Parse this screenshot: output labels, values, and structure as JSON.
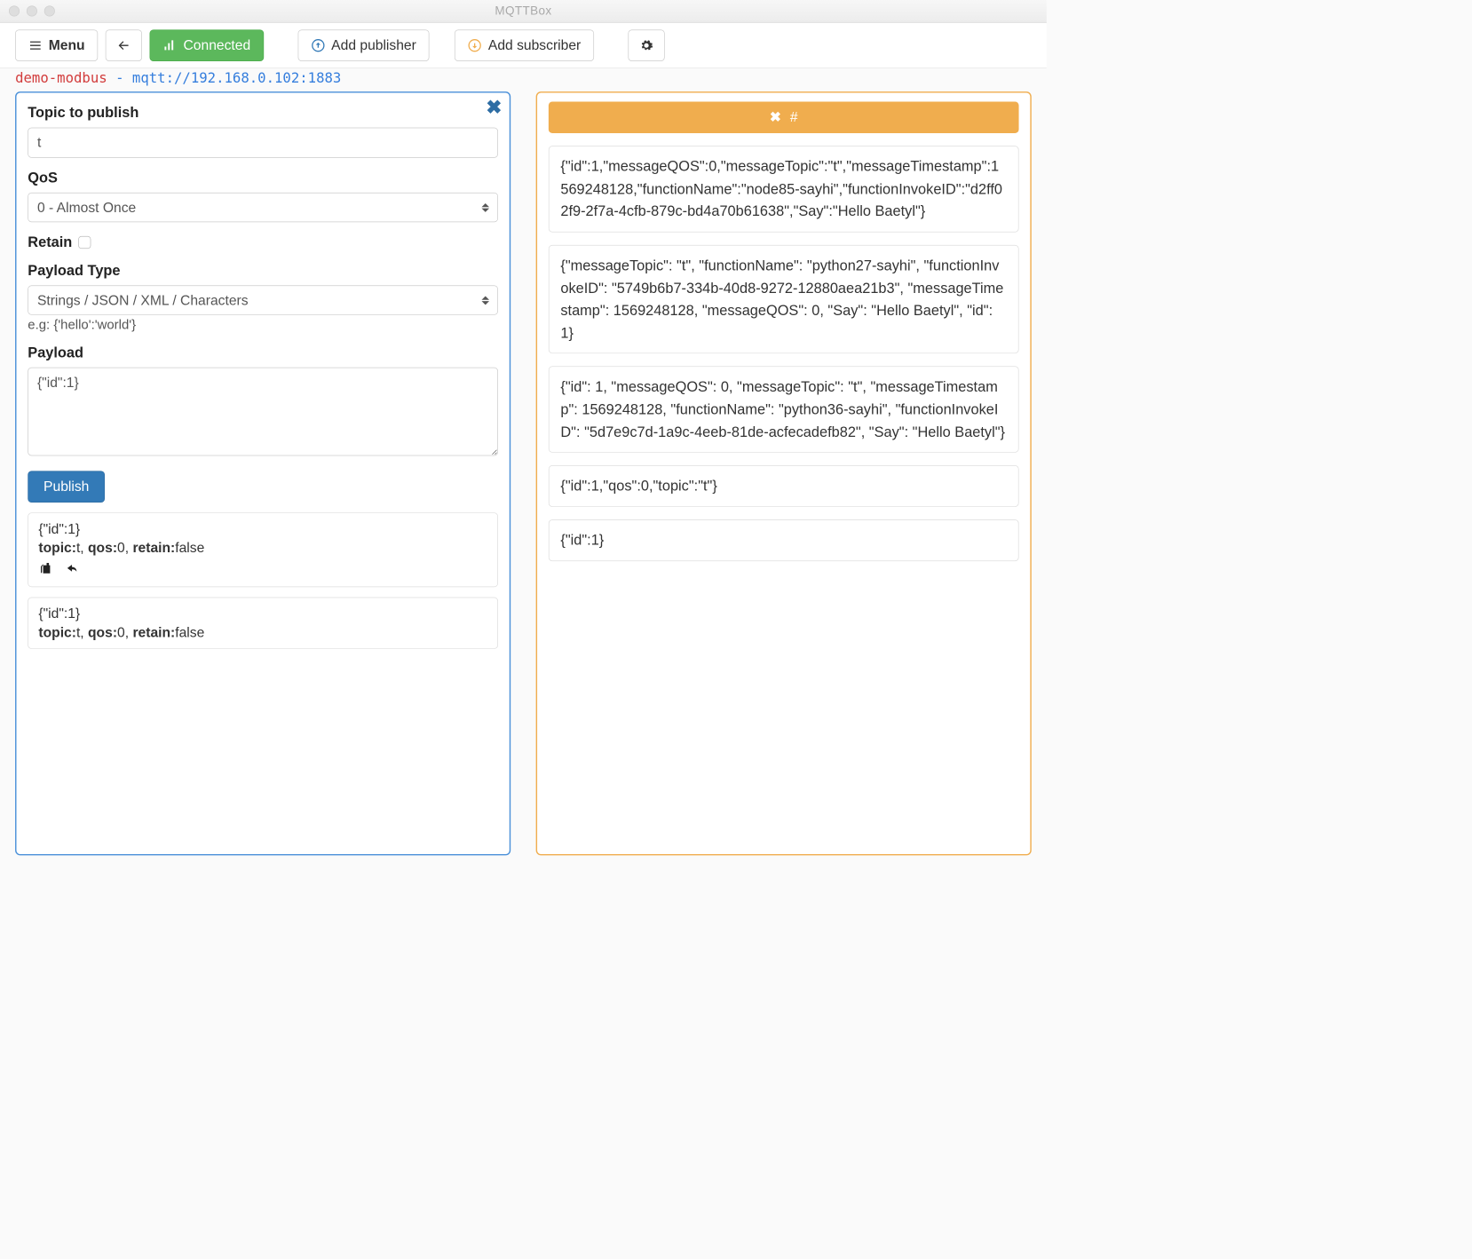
{
  "window": {
    "title": "MQTTBox"
  },
  "toolbar": {
    "menu_label": "Menu",
    "connected_label": "Connected",
    "add_publisher_label": "Add publisher",
    "add_subscriber_label": "Add subscriber"
  },
  "connection": {
    "name": "demo-modbus",
    "separator": "-",
    "url": "mqtt://192.168.0.102:1883"
  },
  "publisher": {
    "topic_label": "Topic to publish",
    "topic_value": "t",
    "qos_label": "QoS",
    "qos_value": "0 - Almost Once",
    "retain_label": "Retain",
    "retain_checked": false,
    "payload_type_label": "Payload Type",
    "payload_type_value": "Strings / JSON / XML / Characters",
    "payload_type_hint": "e.g: {'hello':'world'}",
    "payload_label": "Payload",
    "payload_value": "{\"id\":1}",
    "publish_button": "Publish",
    "history": [
      {
        "payload": "{\"id\":1}",
        "topic_label": "topic:",
        "topic": "t",
        "qos_label": "qos:",
        "qos": "0",
        "retain_label": "retain:",
        "retain": "false"
      },
      {
        "payload": "{\"id\":1}",
        "topic_label": "topic:",
        "topic": "t",
        "qos_label": "qos:",
        "qos": "0",
        "retain_label": "retain:",
        "retain": "false"
      }
    ]
  },
  "subscriber": {
    "topic_glyph": "#",
    "messages": [
      "{\"id\":1,\"messageQOS\":0,\"messageTopic\":\"t\",\"messageTimestamp\":1569248128,\"functionName\":\"node85-sayhi\",\"functionInvokeID\":\"d2ff02f9-2f7a-4cfb-879c-bd4a70b61638\",\"Say\":\"Hello Baetyl\"}",
      "{\"messageTopic\": \"t\", \"functionName\": \"python27-sayhi\", \"functionInvokeID\": \"5749b6b7-334b-40d8-9272-12880aea21b3\", \"messageTimestamp\": 1569248128, \"messageQOS\": 0, \"Say\": \"Hello Baetyl\", \"id\": 1}",
      "{\"id\": 1, \"messageQOS\": 0, \"messageTopic\": \"t\", \"messageTimestamp\": 1569248128, \"functionName\": \"python36-sayhi\", \"functionInvokeID\": \"5d7e9c7d-1a9c-4eeb-81de-acfecadefb82\", \"Say\": \"Hello Baetyl\"}",
      "{\"id\":1,\"qos\":0,\"topic\":\"t\"}",
      "{\"id\":1}"
    ]
  }
}
